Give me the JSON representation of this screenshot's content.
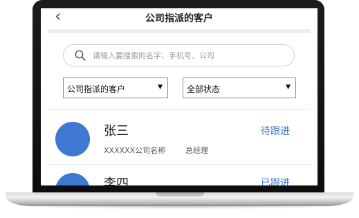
{
  "header": {
    "back_glyph": "‹",
    "title": "公司指派的客户"
  },
  "search": {
    "placeholder": "请输入要搜索的名字、手机号、公司",
    "icon": "search-icon"
  },
  "filters": [
    {
      "selected": "公司指派的客户",
      "arrow": "▼"
    },
    {
      "selected": "全部状态",
      "arrow": "▼"
    }
  ],
  "customers": [
    {
      "name": "张三",
      "company": "XXXXXX公司名称",
      "role": "总经理",
      "status": "待跟进"
    },
    {
      "name": "李四",
      "company": "",
      "role": "",
      "status": "已跟进"
    }
  ],
  "colors": {
    "accent": "#3f78d0",
    "frame": "#111111"
  }
}
